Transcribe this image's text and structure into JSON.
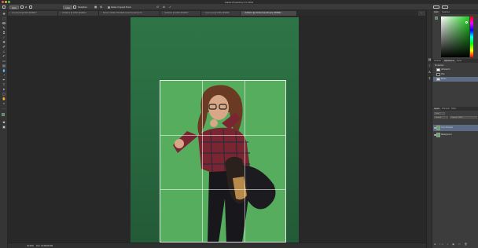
{
  "window": {
    "title": "Adobe Photoshop CC 2014"
  },
  "options_bar": {
    "tool_label": "Ratio",
    "clear_button": "Clear",
    "straighten_label": "Straighten",
    "delete_cropped_label": "Delete Cropped Pixels"
  },
  "tabs": [
    {
      "label": "Icon-01.psd @ 50% (RGB/8) *",
      "active": false
    },
    {
      "label": "Untitled-1 @ 100% (RGB/8) *",
      "active": false
    },
    {
      "label": "Shutter-10-Mar-CW-0028-retouched.psd @ 33...",
      "active": false
    },
    {
      "label": "Untitled-2 @ 200% (RGB/8) *",
      "active": false
    },
    {
      "label": "crop-2.psd @ 100% (RGB/8)",
      "active": false
    },
    {
      "label": "Untitled-3 @ 33.3% (Crop Preview, RGB/8) *",
      "active": true
    }
  ],
  "status_bar": {
    "zoom": "33.33%",
    "doc_info": "Doc: 24.5M/36.6M"
  },
  "panels": {
    "color_tabs": [
      "Color",
      "Swatches"
    ],
    "adjust_tabs": [
      "Libraries",
      "Adjustments",
      "Styles"
    ],
    "properties_label": "Properties",
    "layers_tabs": [
      "Layers",
      "Channels",
      "Paths"
    ],
    "layer_filter": "Kind",
    "blend_mode": "Normal",
    "opacity_label": "Opacity: 100%",
    "layers": [
      {
        "name": "Crop Preview",
        "selected": true
      },
      {
        "name": "Background",
        "selected": false
      }
    ],
    "properties_items": [
      {
        "name": "Artboard 1",
        "selected": false
      },
      {
        "name": "Title",
        "selected": false
      },
      {
        "name": "Photo",
        "selected": true
      }
    ]
  },
  "colors": {
    "green_screen": "#55ad5d",
    "background_green": "#2a6c41",
    "selection": "#5c6c84"
  }
}
